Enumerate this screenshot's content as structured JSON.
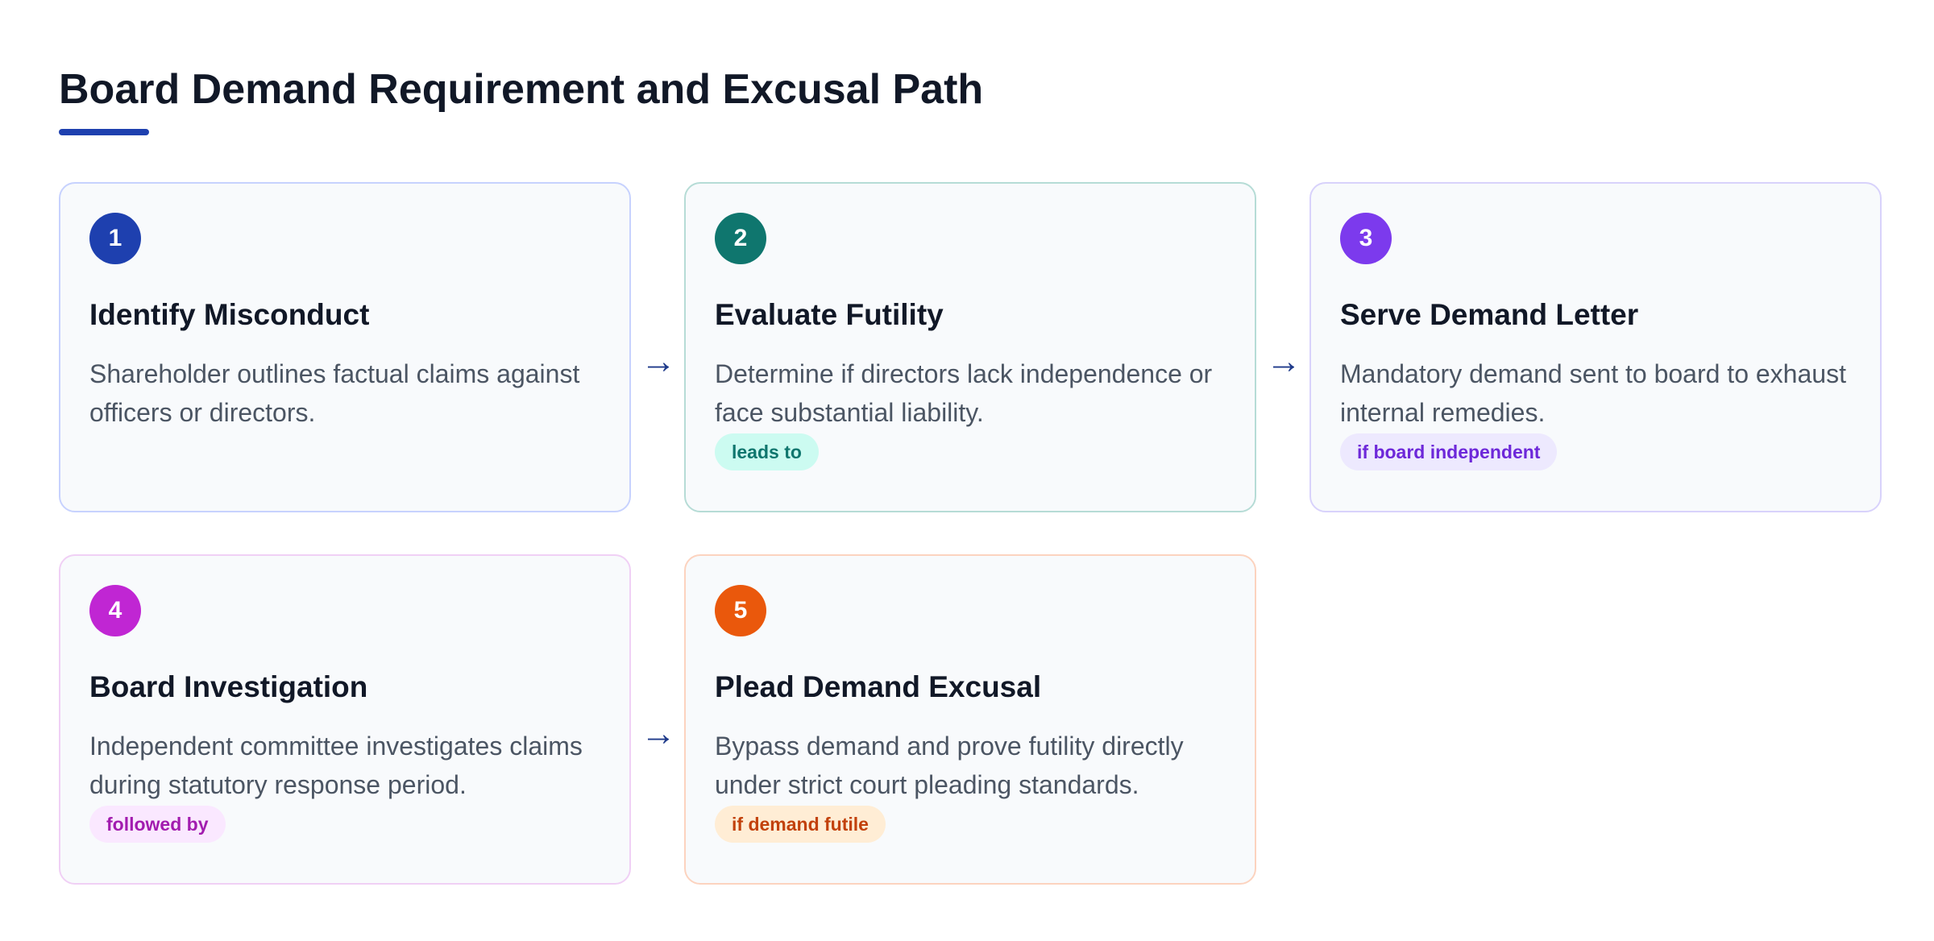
{
  "title": "Board Demand Requirement and Excusal Path",
  "steps": [
    {
      "number": "1",
      "title": "Identify Misconduct",
      "description": "Shareholder outlines factual claims against officers or directors.",
      "tag": ""
    },
    {
      "number": "2",
      "title": "Evaluate Futility",
      "description": "Determine if directors lack independence or face substantial liability.",
      "tag": "leads to"
    },
    {
      "number": "3",
      "title": "Serve Demand Letter",
      "description": "Mandatory demand sent to board to exhaust internal remedies.",
      "tag": "if board independent"
    },
    {
      "number": "4",
      "title": "Board Investigation",
      "description": "Independent committee investigates claims during statutory response period.",
      "tag": "followed by"
    },
    {
      "number": "5",
      "title": "Plead Demand Excusal",
      "description": "Bypass demand and prove futility directly under strict court pleading standards.",
      "tag": "if demand futile"
    }
  ],
  "arrow_glyph": "→",
  "colors": {
    "title_accent": "#1e40af",
    "step1": "#1e40af",
    "step2": "#0f766e",
    "step3": "#7c3aed",
    "step4": "#c026d3",
    "step5": "#ea580c"
  }
}
